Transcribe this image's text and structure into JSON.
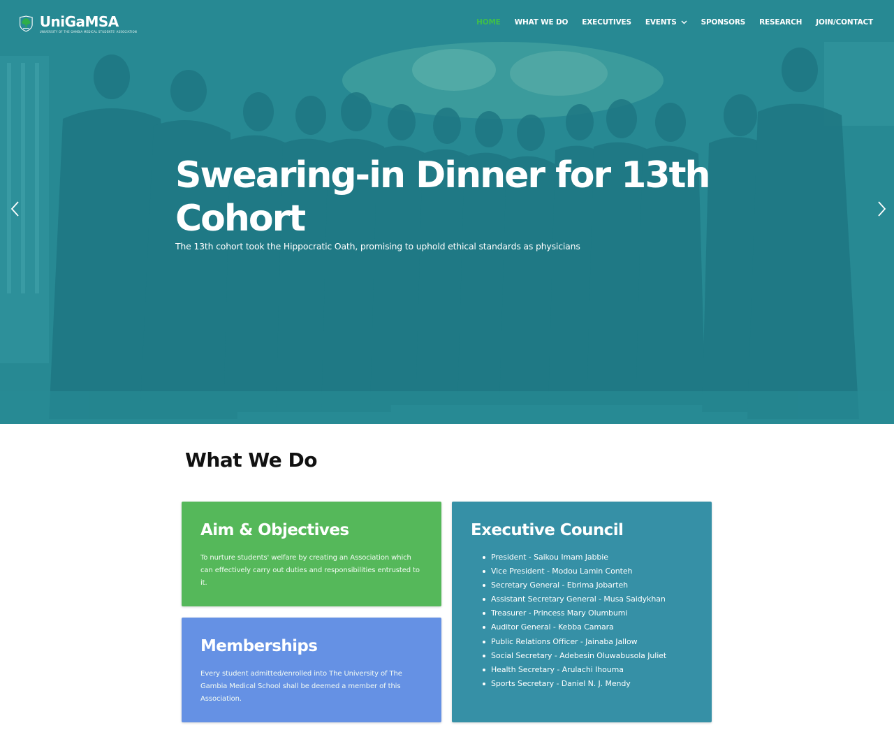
{
  "brand": {
    "name": "UniGaMSA",
    "tagline": "UNIVERSITY OF THE GAMBIA MEDICAL STUDENTS' ASSOCIATION"
  },
  "nav": {
    "items": [
      {
        "label": "HOME",
        "active": true
      },
      {
        "label": "WHAT WE DO",
        "active": false
      },
      {
        "label": "EXECUTIVES",
        "active": false
      },
      {
        "label": "EVENTS",
        "active": false,
        "has_dropdown": true
      },
      {
        "label": "SPONSORS",
        "active": false
      },
      {
        "label": "RESEARCH",
        "active": false
      },
      {
        "label": "JOIN/CONTACT",
        "active": false
      }
    ],
    "active_color": "#3fbf4a",
    "dropdown_icon": "chevron-down-icon"
  },
  "hero": {
    "title": "Swearing-in Dinner for 13th Cohort",
    "subtitle": "The 13th cohort took the Hippocratic Oath, promising to uphold ethical standards as physicians",
    "prev_icon": "chevron-left-icon",
    "next_icon": "chevron-right-icon",
    "overlay_color": "#2a8590"
  },
  "what_we_do": {
    "title": "What We Do",
    "aim": {
      "title": "Aim & Objectives",
      "body": "To nurture students' welfare by creating an Association which can effectively carry out duties and responsibilities entrusted to it.",
      "color": "#55b85a"
    },
    "memberships": {
      "title": "Memberships",
      "body": "Every student admitted/enrolled into The University of The Gambia Medical School shall be deemed a member of this Association.",
      "color": "#6591e4"
    },
    "executive": {
      "title": "Executive Council",
      "color": "#3690a6",
      "members": [
        "President - Saikou Imam Jabbie",
        "Vice President - Modou Lamin Conteh",
        "Secretary General - Ebrima Jobarteh",
        "Assistant Secretary General - Musa Saidykhan",
        "Treasurer - Princess Mary Olumbumi",
        "Auditor General - Kebba Camara",
        "Public Relations Officer - Jainaba Jallow",
        "Social Secretary - Adebesin Oluwabusola Juliet",
        "Health Secretary - Arulachi Ihouma",
        "Sports Secretary - Daniel N. J. Mendy"
      ]
    }
  }
}
